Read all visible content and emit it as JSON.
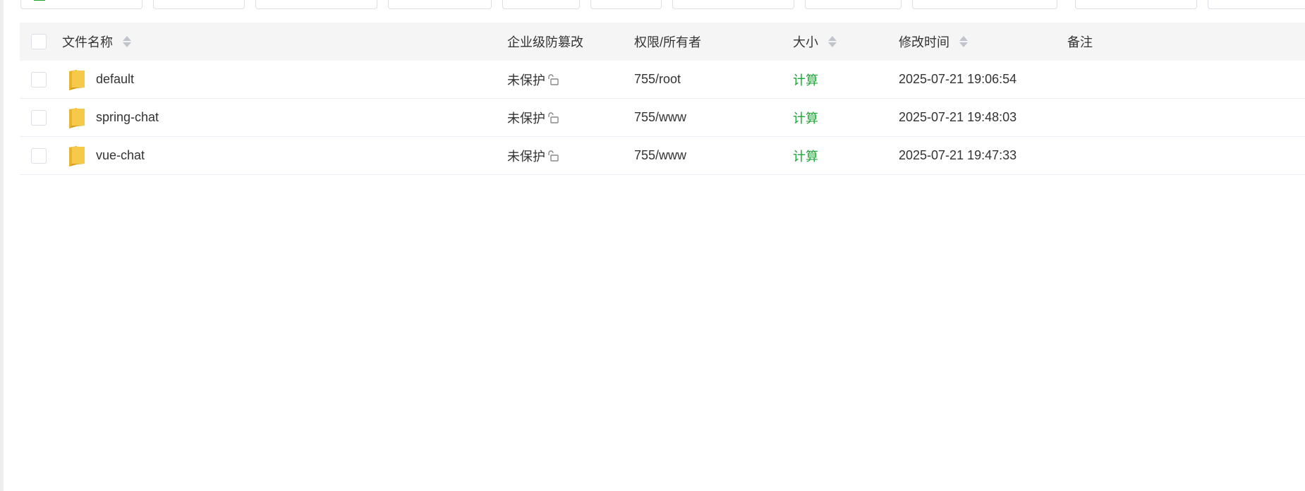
{
  "toolbar": {
    "buttons": [
      {
        "id": "btn-1"
      },
      {
        "id": "btn-2"
      },
      {
        "id": "btn-3"
      },
      {
        "id": "btn-4"
      },
      {
        "id": "btn-5"
      },
      {
        "id": "btn-6"
      },
      {
        "id": "btn-7"
      },
      {
        "id": "btn-8"
      },
      {
        "id": "btn-9"
      },
      {
        "id": "btn-10"
      },
      {
        "id": "btn-11"
      }
    ]
  },
  "table": {
    "headers": {
      "name": "文件名称",
      "protection": "企业级防篡改",
      "permission": "权限/所有者",
      "size": "大小",
      "modified": "修改时间",
      "note": "备注"
    },
    "rows": [
      {
        "name": "default",
        "protection": "未保护",
        "permission": "755/root",
        "size": "计算",
        "modified": "2025-07-21 19:06:54",
        "note": ""
      },
      {
        "name": "spring-chat",
        "protection": "未保护",
        "permission": "755/www",
        "size": "计算",
        "modified": "2025-07-21 19:48:03",
        "note": ""
      },
      {
        "name": "vue-chat",
        "protection": "未保护",
        "permission": "755/www",
        "size": "计算",
        "modified": "2025-07-21 19:47:33",
        "note": ""
      }
    ]
  },
  "colors": {
    "accent": "#20a53a",
    "folder": "#f6c94b",
    "header_bg": "#f5f5f5",
    "border": "#dcdfe6"
  }
}
